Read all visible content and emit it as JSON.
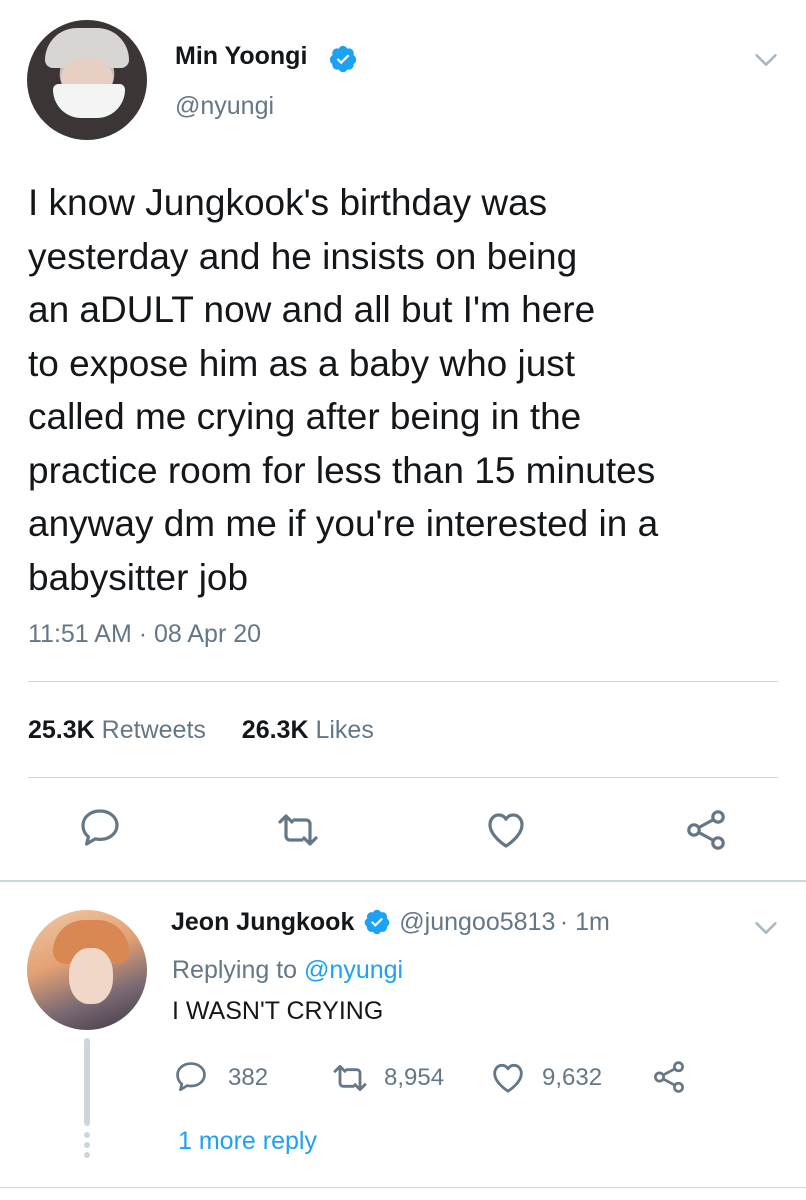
{
  "main_tweet": {
    "author_name": "Min Yoongi",
    "author_handle": "@nyungi",
    "text_lines": [
      "I know Jungkook's birthday was",
      "yesterday and he insists on being",
      "an aDULT now and all but I'm here",
      "to expose him as a baby who just",
      "called me crying after being in the",
      "practice room for less than 15 minutes",
      "anyway dm me if you're interested in a",
      "babysitter job"
    ],
    "timestamp": "11:51 AM · 08 Apr 20",
    "retweets_count": "25.3K",
    "retweets_label": "Retweets",
    "likes_count": "26.3K",
    "likes_label": "Likes"
  },
  "reply": {
    "author_name": "Jeon Jungkook",
    "author_handle": "@jungoo5813",
    "time_ago": "· 1m",
    "replying_prefix": "Replying to",
    "replying_handle": "@nyungi",
    "text": "I WASN'T CRYING",
    "reply_count": "382",
    "retweet_count": "8,954",
    "like_count": "9,632",
    "more_replies": "1 more reply"
  },
  "icons": [
    "chevron-down-icon",
    "verified-badge-icon",
    "reply-icon",
    "retweet-icon",
    "like-icon",
    "share-icon"
  ],
  "colors": {
    "verified": "#1da1f2",
    "link": "#1da1f2",
    "secondary_text": "#657786",
    "divider": "#ccd6dd"
  }
}
